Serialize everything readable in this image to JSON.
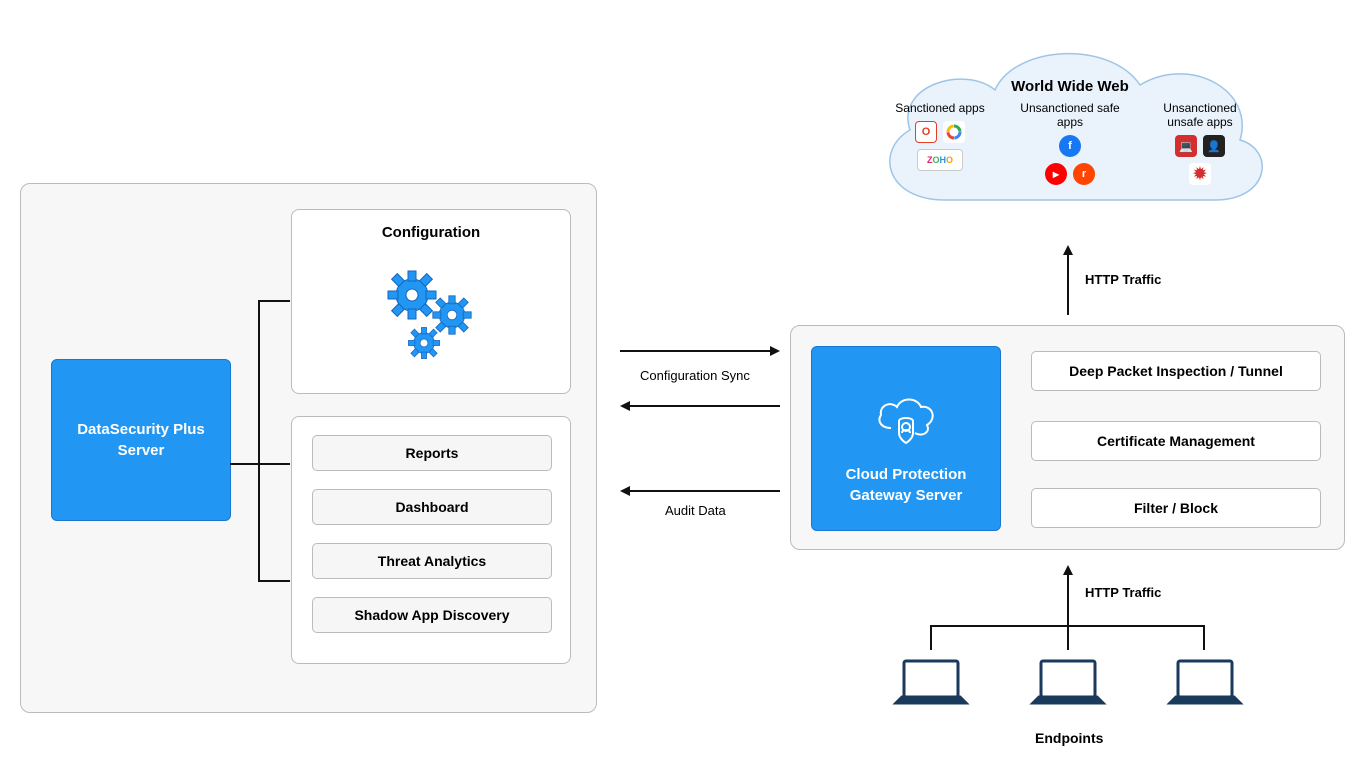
{
  "left_server": {
    "title": "DataSecurity Plus\nServer",
    "configuration": {
      "title": "Configuration"
    },
    "modules": {
      "reports": "Reports",
      "dashboard": "Dashboard",
      "threat": "Threat Analytics",
      "shadow": "Shadow App Discovery"
    }
  },
  "gateway": {
    "title": "Cloud Protection\nGateway Server",
    "features": {
      "dpi": "Deep Packet Inspection / Tunnel",
      "cert": "Certificate Management",
      "filter": "Filter / Block"
    }
  },
  "cloud": {
    "title": "World Wide Web",
    "columns": {
      "sanctioned": "Sanctioned apps",
      "unsanctioned_safe": "Unsanctioned safe apps",
      "unsanctioned_unsafe": "Unsanctioned unsafe apps"
    }
  },
  "arrows": {
    "config_sync": "Configuration Sync",
    "audit_data": "Audit Data",
    "http_traffic_top": "HTTP Traffic",
    "http_traffic_bottom": "HTTP Traffic"
  },
  "endpoints": {
    "label": "Endpoints"
  }
}
